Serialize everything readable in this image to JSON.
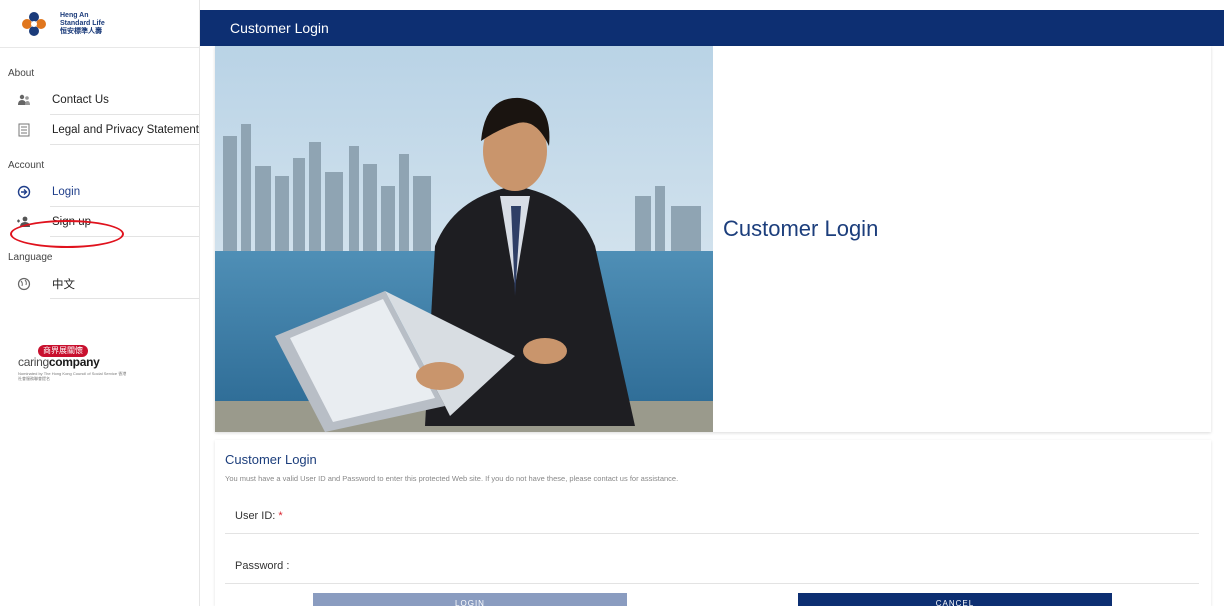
{
  "brand": {
    "name_line1": "Heng An",
    "name_line2": "Standard Life",
    "name_line3": "恒安標準人壽",
    "accent": "#0d2f72"
  },
  "sidebar": {
    "sections": [
      {
        "label": "About",
        "items": [
          {
            "label": "Contact Us",
            "icon": "contact-users-icon"
          },
          {
            "label": "Legal and Privacy Statement",
            "icon": "document-icon"
          }
        ]
      },
      {
        "label": "Account",
        "items": [
          {
            "label": "Login",
            "icon": "login-arrow-icon"
          },
          {
            "label": "Sign up",
            "icon": "add-user-icon"
          }
        ]
      },
      {
        "label": "Language",
        "items": [
          {
            "label": "中文",
            "icon": "globe-icon"
          }
        ]
      }
    ],
    "caring": {
      "badge": "商界展關懷",
      "word_prefix": "caring",
      "word_bold": "company",
      "fine_print": "Nominated by The Hong Kong Council of Social Service 香港社會服務聯會提名"
    }
  },
  "header": {
    "title": "Customer Login"
  },
  "hero": {
    "title": "Customer Login"
  },
  "form": {
    "title": "Customer Login",
    "description": "You must have a valid User ID and Password to enter this protected Web site. If you do not have these, please contact us for assistance.",
    "userid_label": "User ID:",
    "required_mark": "*",
    "password_label": "Password :",
    "login_button": "LOGIN",
    "cancel_button": "CANCEL"
  }
}
